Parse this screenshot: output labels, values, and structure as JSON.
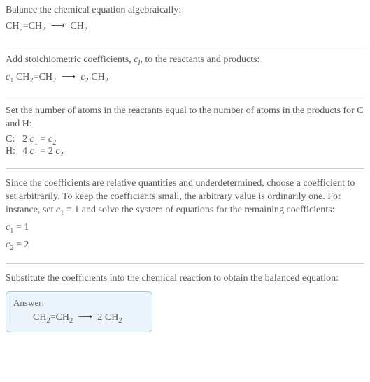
{
  "s1": {
    "line1": "Balance the chemical equation algebraically:"
  },
  "s2": {
    "line1_a": "Add stoichiometric coefficients, ",
    "line1_c": ", to the reactants and products:"
  },
  "s3": {
    "line1": "Set the number of atoms in the reactants equal to the number of atoms in the products for C and H:",
    "c_label": "C:",
    "h_label": "H:"
  },
  "s4": {
    "line1_a": "Since the coefficients are relative quantities and underdetermined, choose a coefficient to set arbitrarily. To keep the coefficients small, the arbitrary value is ordinarily one. For instance, set ",
    "line1_b": " and solve the system of equations for the remaining coefficients:"
  },
  "s5": {
    "line1": "Substitute the coefficients into the chemical reaction to obtain the balanced equation:"
  },
  "answer": {
    "label": "Answer:"
  },
  "chart_data": {
    "type": "table",
    "title": "Chemical equation balancing",
    "reaction_unbalanced": {
      "reactants": [
        "CH2=CH2"
      ],
      "products": [
        "CH2"
      ]
    },
    "reaction_with_coeffs": {
      "reactants": [
        {
          "coeff": "c1",
          "species": "CH2=CH2"
        }
      ],
      "products": [
        {
          "coeff": "c2",
          "species": "CH2"
        }
      ]
    },
    "atom_balance_equations": [
      {
        "element": "C",
        "equation": "2 c1 = c2"
      },
      {
        "element": "H",
        "equation": "4 c1 = 2 c2"
      }
    ],
    "arbitrary_assignment": "c1 = 1",
    "solution": {
      "c1": 1,
      "c2": 2
    },
    "balanced_equation": {
      "reactants": [
        {
          "coeff": 1,
          "species": "CH2=CH2"
        }
      ],
      "products": [
        {
          "coeff": 2,
          "species": "CH2"
        }
      ],
      "text": "CH2=CH2 ⟶ 2 CH2"
    }
  }
}
